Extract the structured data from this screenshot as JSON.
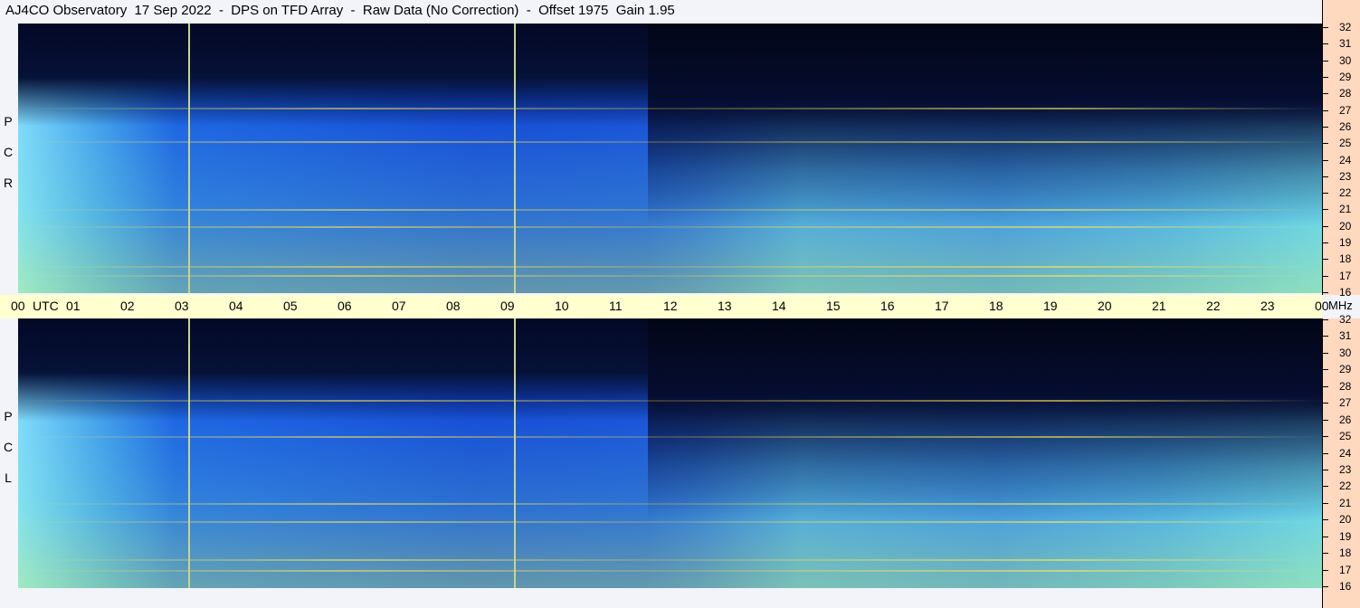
{
  "title": "AJ4CO Observatory  17 Sep 2022  -  DPS on TFD Array  -  Raw Data (No Correction)  -  Offset 1975  Gain 1.95",
  "polarizations": {
    "top": [
      "R",
      "C",
      "P"
    ],
    "bottom": [
      "L",
      "C",
      "P"
    ]
  },
  "time_axis": {
    "labels": [
      "00",
      "UTC",
      "01",
      "02",
      "03",
      "04",
      "05",
      "06",
      "07",
      "08",
      "09",
      "10",
      "11",
      "12",
      "13",
      "14",
      "15",
      "16",
      "17",
      "18",
      "19",
      "20",
      "21",
      "22",
      "23",
      "00"
    ],
    "unit": "MHz"
  },
  "freq_axis": {
    "labels": [
      "32",
      "31",
      "30",
      "29",
      "28",
      "27",
      "26",
      "25",
      "24",
      "23",
      "22",
      "21",
      "20",
      "19",
      "18",
      "17",
      "16"
    ]
  },
  "colors": {
    "background": "#f2f4fa",
    "time_strip": "#ffffd0",
    "freq_strip": "#ffd8c0",
    "low_signal": "#0a1a5a",
    "mid_signal": "#1459e6",
    "high_signal": "#7cf0a0"
  },
  "chart_data": {
    "type": "heatmap",
    "title": "AJ4CO Observatory  17 Sep 2022  -  DPS on TFD Array  -  Raw Data (No Correction)  -  Offset 1975  Gain 1.95",
    "panels": [
      "RCP",
      "LCP"
    ],
    "x_range_utc_hours": [
      0,
      24
    ],
    "y_range_mhz": [
      16,
      32
    ],
    "vertical_lines_utc_hours": [
      3.2,
      9.2
    ],
    "dark_region_utc_hours": [
      11.6,
      24
    ],
    "notable_bands_mhz": [
      17,
      17.7,
      18,
      20,
      21,
      25,
      27,
      28
    ]
  }
}
